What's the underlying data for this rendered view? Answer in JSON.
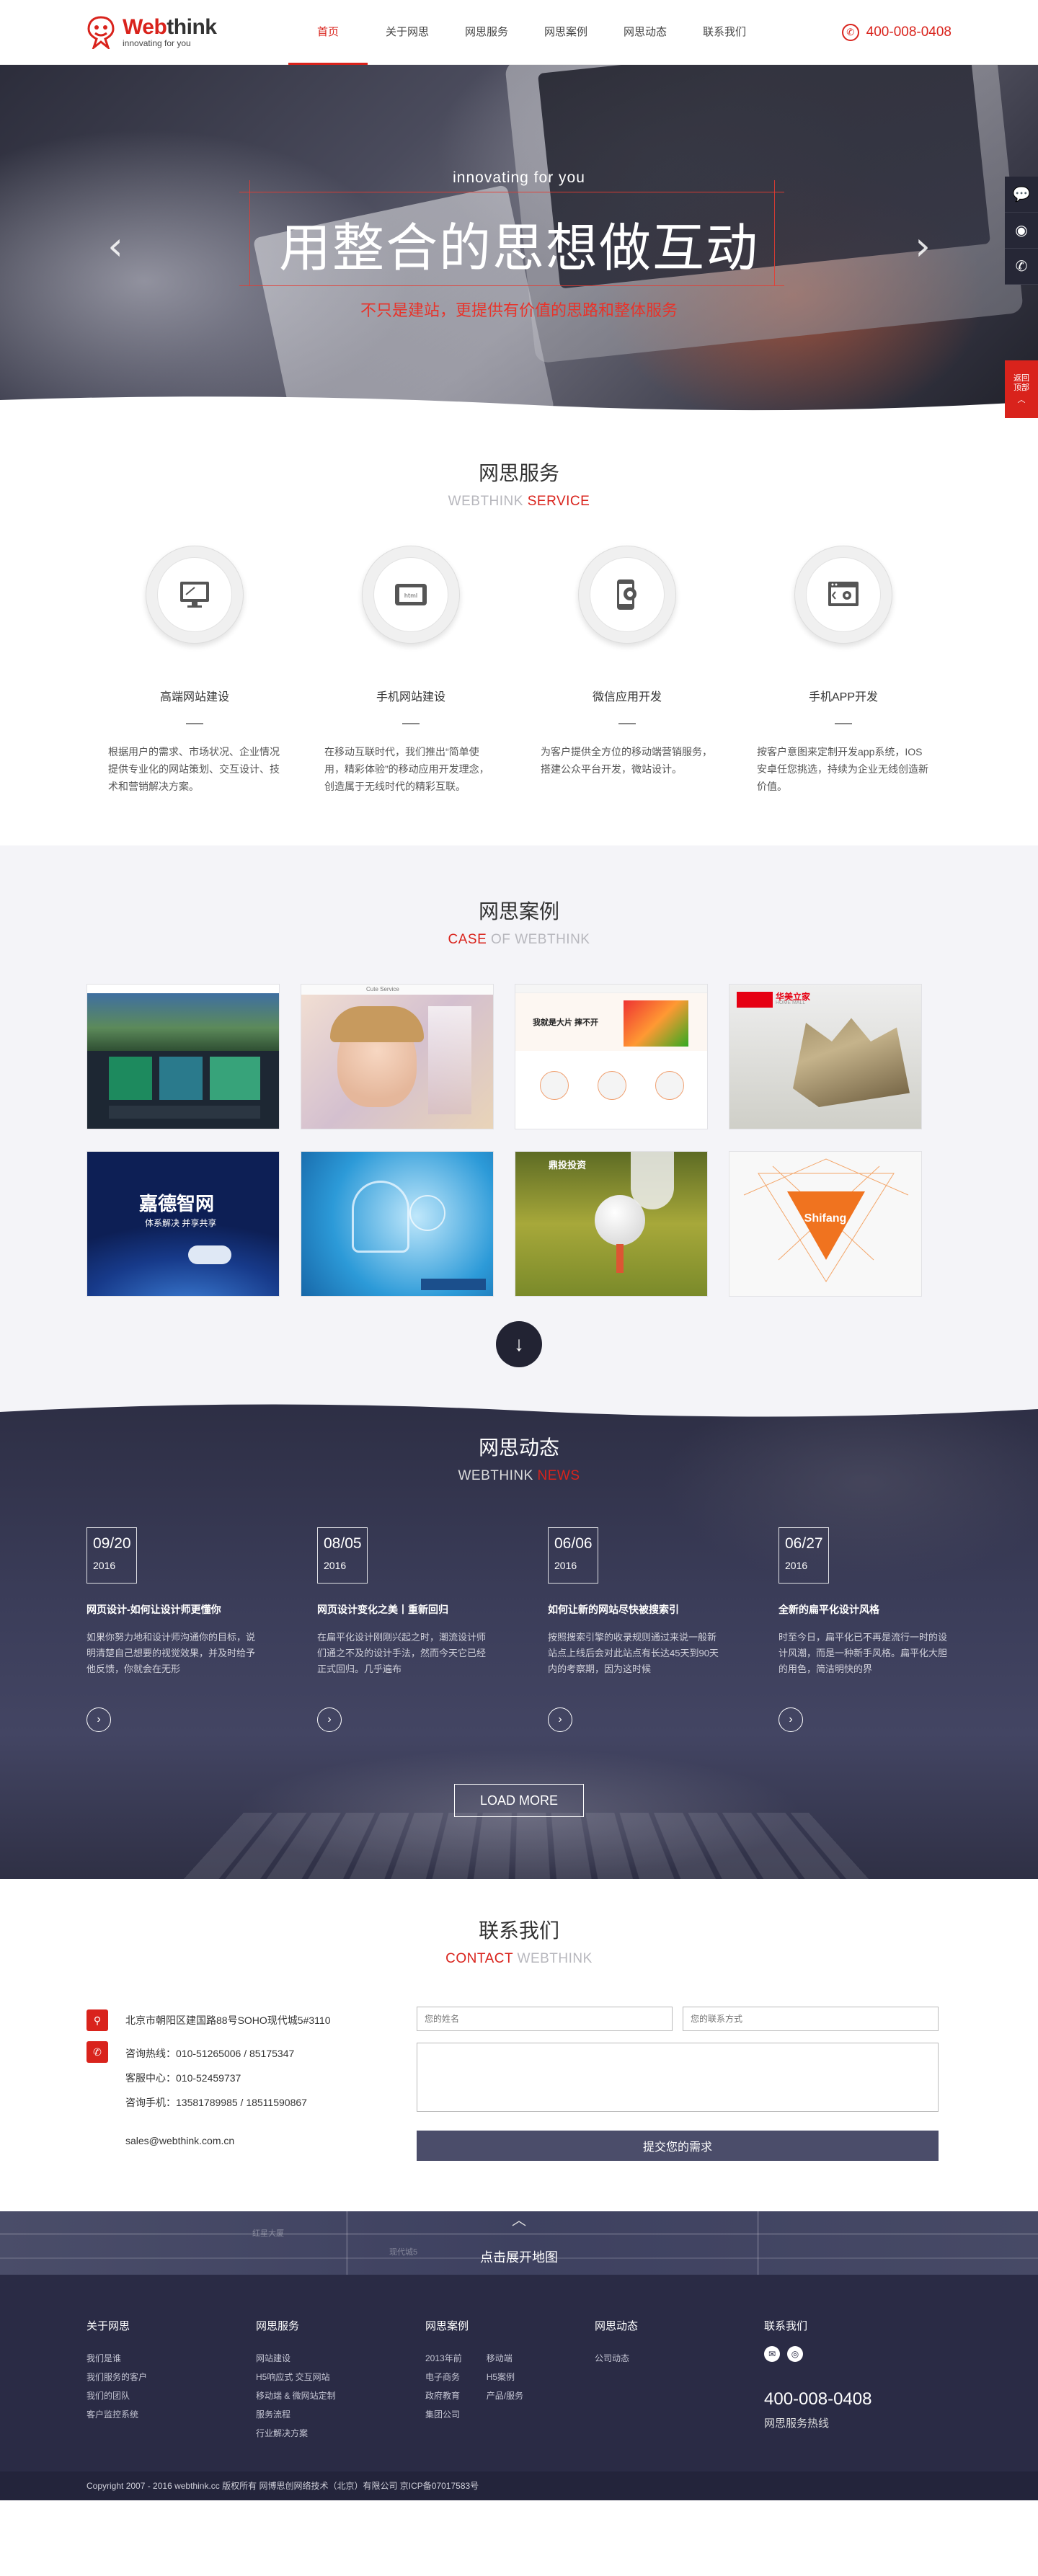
{
  "brand": {
    "name_a": "Web",
    "name_b": "think",
    "slogan": "innovating for you"
  },
  "nav": [
    "首页",
    "关于网思",
    "网思服务",
    "网思案例",
    "网思动态",
    "联系我们"
  ],
  "hotline": "400-008-0408",
  "hero": {
    "tag": "innovating for you",
    "title": "用整合的思想做互动",
    "subtitle": "不只是建站，更提供有价值的思路和整体服务"
  },
  "side": {
    "top_label": "返回顶部"
  },
  "services": {
    "title": "网思服务",
    "en_a": "WEBTHINK ",
    "en_b": "SERVICE",
    "items": [
      {
        "name": "高端网站建设",
        "icon": "monitor-icon",
        "desc": "根据用户的需求、市场状况、企业情况提供专业化的网站策划、交互设计、技术和营销解决方案。"
      },
      {
        "name": "手机网站建设",
        "icon": "mobile-web-icon",
        "desc": "在移动互联时代，我们推出“简单使用，精彩体验”的移动应用开发理念，创造属于无线时代的精彩互联。"
      },
      {
        "name": "微信应用开发",
        "icon": "phone-gear-icon",
        "desc": "为客户提供全方位的移动端营销服务，搭建公众平台开发，微站设计。"
      },
      {
        "name": "手机APP开发",
        "icon": "app-window-icon",
        "desc": "按客户意图来定制开发app系统，IOS 安卓任您挑选，持续为企业无线创造新价值。"
      }
    ]
  },
  "cases": {
    "title": "网思案例",
    "en_a": "CASE",
    "en_b": " OF WEBTHINK",
    "labels": [
      "嘉德智网",
      "体系解决 并享共享",
      "华美立家",
      "HOME MALL",
      "Shifang",
      "Cute Service",
      "鼎投投资",
      "我就是大片 摔不开"
    ]
  },
  "news": {
    "title": "网思动态",
    "en_a": "WEBTHINK ",
    "en_b": "NEWS",
    "items": [
      {
        "date": "09/20",
        "year": "2016",
        "title": "网页设计-如何让设计师更懂你",
        "desc": "如果你努力地和设计师沟通你的目标，说明清楚自己想要的视觉效果，并及时给予他反馈，你就会在无形"
      },
      {
        "date": "08/05",
        "year": "2016",
        "title": "网页设计变化之美丨重新回归",
        "desc": "在扁平化设计刚刚兴起之时，潮流设计师们通之不及的设计手法，然而今天它已经正式回归。几乎遍布"
      },
      {
        "date": "06/06",
        "year": "2016",
        "title": "如何让新的网站尽快被搜索引",
        "desc": "按照搜索引擎的收录规则通过来说一般新站点上线后会对此站点有长达45天到90天内的考察期，因为这时候"
      },
      {
        "date": "06/27",
        "year": "2016",
        "title": "全新的扁平化设计风格",
        "desc": "时至今日，扁平化已不再是流行一时的设计风潮，而是一种新手风格。扁平化大胆的用色，简洁明快的界"
      }
    ],
    "load_more": "LOAD MORE"
  },
  "contact": {
    "title": "联系我们",
    "en_a": "CONTACT",
    "en_b": " WEBTHINK",
    "address": "北京市朝阳区建国路88号SOHO现代城5#3110",
    "phone_lines": [
      "咨询热线：010-51265006 / 85175347",
      "客服中心：010-52459737",
      "咨询手机：13581789985 / 18511590867"
    ],
    "email": "sales@webthink.com.cn",
    "name_placeholder": "您的姓名",
    "contact_placeholder": "您的联系方式",
    "submit": "提交您的需求"
  },
  "map": {
    "toggle": "点击展开地图",
    "labels": [
      "红星大厦",
      "现代城5"
    ]
  },
  "footer": {
    "cols": [
      {
        "title": "关于网思",
        "lists": [
          [
            "我们是谁",
            "我们服务的客户",
            "我们的团队",
            "客户监控系统"
          ]
        ]
      },
      {
        "title": "网思服务",
        "lists": [
          [
            "网站建设",
            "H5响应式 交互网站",
            "移动端 & 微网站定制",
            "服务流程",
            "行业解决方案"
          ]
        ]
      },
      {
        "title": "网思案例",
        "lists": [
          [
            "2013年前",
            "电子商务",
            "政府教育",
            "集团公司"
          ],
          [
            "移动端",
            "H5案例",
            "产品/服务"
          ]
        ]
      },
      {
        "title": "网思动态",
        "lists": [
          [
            "公司动态"
          ]
        ]
      }
    ],
    "contact_title": "联系我们",
    "tel": "400-008-0408",
    "tel_label": "网思服务热线",
    "copyright": "Copyright 2007 - 2016 webthink.cc  版权所有 网博思创网络技术（北京）有限公司  京ICP备07017583号"
  }
}
